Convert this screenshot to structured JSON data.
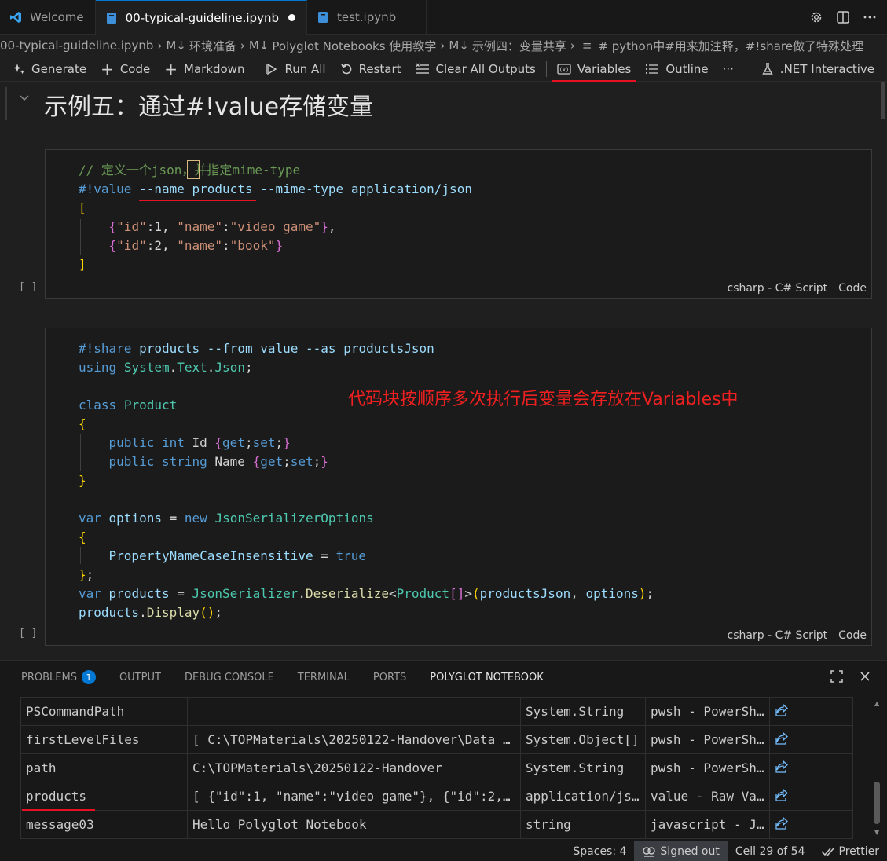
{
  "tabs": [
    {
      "label": "Welcome",
      "icon": "vscode-icon",
      "active": false
    },
    {
      "label": "00-typical-guideline.ipynb",
      "icon": "notebook-icon",
      "active": true,
      "dirty": true
    },
    {
      "label": "test.ipynb",
      "icon": "notebook-icon",
      "active": false
    }
  ],
  "breadcrumb": {
    "items": [
      "00-typical-guideline.ipynb",
      "环境准备",
      "Polyglot Notebooks 使用教学",
      "示例四：变量共享",
      "# python中#用来加注释，#!share做了特殊处理"
    ],
    "md_prefix": "M↓"
  },
  "toolbar": {
    "generate": "Generate",
    "code": "Code",
    "markdown": "Markdown",
    "run_all": "Run All",
    "restart": "Restart",
    "clear_outputs": "Clear All Outputs",
    "variables": "Variables",
    "outline": "Outline",
    "more": "···",
    "kernel": ".NET Interactive"
  },
  "markdown_cell": {
    "heading": "示例五：通过#!value存储变量"
  },
  "cell1": {
    "lines": [
      [
        [
          "cm",
          "// 定义一个json，并指定mime-type"
        ]
      ],
      [
        [
          "kw",
          "#!value"
        ],
        [
          "plain",
          " "
        ],
        [
          "var",
          "--name"
        ],
        [
          "plain",
          " "
        ],
        [
          "var",
          "products"
        ],
        [
          "plain",
          " "
        ],
        [
          "var",
          "--mime-type"
        ],
        [
          "plain",
          " "
        ],
        [
          "var",
          "application/json"
        ]
      ],
      [
        [
          "br1",
          "["
        ]
      ],
      [
        [
          "plain",
          "    "
        ],
        [
          "br2",
          "{"
        ],
        [
          "str",
          "\"id\""
        ],
        [
          "plain",
          ":1, "
        ],
        [
          "str",
          "\"name\""
        ],
        [
          "plain",
          ":"
        ],
        [
          "str",
          "\"video game\""
        ],
        [
          "br2",
          "}"
        ],
        [
          "plain",
          ","
        ]
      ],
      [
        [
          "plain",
          "    "
        ],
        [
          "br2",
          "{"
        ],
        [
          "str",
          "\"id\""
        ],
        [
          "plain",
          ":2, "
        ],
        [
          "str",
          "\"name\""
        ],
        [
          "plain",
          ":"
        ],
        [
          "str",
          "\"book\""
        ],
        [
          "br2",
          "}"
        ]
      ],
      [
        [
          "br1",
          "]"
        ]
      ]
    ],
    "exec": "[ ]",
    "language": "csharp - C# Script",
    "type": "Code"
  },
  "cell2": {
    "lines": [
      [
        [
          "kw",
          "#!share"
        ],
        [
          "plain",
          " "
        ],
        [
          "var",
          "products"
        ],
        [
          "plain",
          " "
        ],
        [
          "var",
          "--from"
        ],
        [
          "plain",
          " "
        ],
        [
          "var",
          "value"
        ],
        [
          "plain",
          " "
        ],
        [
          "var",
          "--as"
        ],
        [
          "plain",
          " "
        ],
        [
          "var",
          "productsJson"
        ]
      ],
      [
        [
          "kw",
          "using"
        ],
        [
          "plain",
          " "
        ],
        [
          "typ",
          "System"
        ],
        [
          "plain",
          "."
        ],
        [
          "typ",
          "Text"
        ],
        [
          "plain",
          "."
        ],
        [
          "typ",
          "Json"
        ],
        [
          "plain",
          ";"
        ]
      ],
      [
        [
          "plain",
          ""
        ]
      ],
      [
        [
          "kw",
          "class"
        ],
        [
          "plain",
          " "
        ],
        [
          "typ",
          "Product"
        ]
      ],
      [
        [
          "br1",
          "{"
        ]
      ],
      [
        [
          "plain",
          "    "
        ],
        [
          "kw",
          "public"
        ],
        [
          "plain",
          " "
        ],
        [
          "kw",
          "int"
        ],
        [
          "plain",
          " Id "
        ],
        [
          "br2",
          "{"
        ],
        [
          "kw",
          "get"
        ],
        [
          "plain",
          ";"
        ],
        [
          "kw",
          "set"
        ],
        [
          "plain",
          ";"
        ],
        [
          "br2",
          "}"
        ]
      ],
      [
        [
          "plain",
          "    "
        ],
        [
          "kw",
          "public"
        ],
        [
          "plain",
          " "
        ],
        [
          "kw",
          "string"
        ],
        [
          "plain",
          " Name "
        ],
        [
          "br2",
          "{"
        ],
        [
          "kw",
          "get"
        ],
        [
          "plain",
          ";"
        ],
        [
          "kw",
          "set"
        ],
        [
          "plain",
          ";"
        ],
        [
          "br2",
          "}"
        ]
      ],
      [
        [
          "br1",
          "}"
        ]
      ],
      [
        [
          "plain",
          ""
        ]
      ],
      [
        [
          "kw",
          "var"
        ],
        [
          "plain",
          " "
        ],
        [
          "var",
          "options"
        ],
        [
          "plain",
          " = "
        ],
        [
          "kw",
          "new"
        ],
        [
          "plain",
          " "
        ],
        [
          "typ",
          "JsonSerializerOptions"
        ]
      ],
      [
        [
          "br1",
          "{"
        ]
      ],
      [
        [
          "plain",
          "    "
        ],
        [
          "var",
          "PropertyNameCaseInsensitive"
        ],
        [
          "plain",
          " = "
        ],
        [
          "kw",
          "true"
        ]
      ],
      [
        [
          "br1",
          "}"
        ],
        [
          "plain",
          ";"
        ]
      ],
      [
        [
          "kw",
          "var"
        ],
        [
          "plain",
          " "
        ],
        [
          "var",
          "products"
        ],
        [
          "plain",
          " = "
        ],
        [
          "typ",
          "JsonSerializer"
        ],
        [
          "plain",
          "."
        ],
        [
          "fn",
          "Deserialize"
        ],
        [
          "plain",
          "<"
        ],
        [
          "typ",
          "Product"
        ],
        [
          "br2",
          "[]"
        ],
        [
          "plain",
          ">"
        ],
        [
          "br1",
          "("
        ],
        [
          "var",
          "productsJson"
        ],
        [
          "plain",
          ", "
        ],
        [
          "var",
          "options"
        ],
        [
          "br1",
          ")"
        ],
        [
          "plain",
          ";"
        ]
      ],
      [
        [
          "var",
          "products"
        ],
        [
          "plain",
          "."
        ],
        [
          "fn",
          "Display"
        ],
        [
          "br1",
          "()"
        ],
        [
          "plain",
          ";"
        ]
      ]
    ],
    "exec": "[ ]",
    "language": "csharp - C# Script",
    "type": "Code"
  },
  "annotation": "代码块按顺序多次执行后变量会存放在Variables中",
  "panel": {
    "tabs": [
      {
        "label": "PROBLEMS",
        "badge": "1"
      },
      {
        "label": "OUTPUT"
      },
      {
        "label": "DEBUG CONSOLE"
      },
      {
        "label": "TERMINAL"
      },
      {
        "label": "PORTS"
      },
      {
        "label": "POLYGLOT NOTEBOOK",
        "active": true
      }
    ],
    "variables": [
      {
        "name": "PSCommandPath",
        "value": "",
        "type": "System.String",
        "kernel": "pwsh - PowerSh…"
      },
      {
        "name": "firstLevelFiles",
        "value": "[ C:\\TOPMaterials\\20250122-Handover\\Data …",
        "type": "System.Object[]",
        "kernel": "pwsh - PowerSh…"
      },
      {
        "name": "path",
        "value": "C:\\TOPMaterials\\20250122-Handover",
        "type": "System.String",
        "kernel": "pwsh - PowerSh…"
      },
      {
        "name": "products",
        "value": "[ {\"id\":1, \"name\":\"video game\"}, {\"id\":2,…",
        "type": "application/js…",
        "kernel": "value - Raw Va…"
      },
      {
        "name": "message03",
        "value": "Hello Polyglot Notebook",
        "type": "string",
        "kernel": "javascript - J…"
      }
    ]
  },
  "statusbar": {
    "spaces": "Spaces: 4",
    "signed_out": "Signed out",
    "cell": "Cell 29 of 54",
    "prettier": "Prettier"
  }
}
